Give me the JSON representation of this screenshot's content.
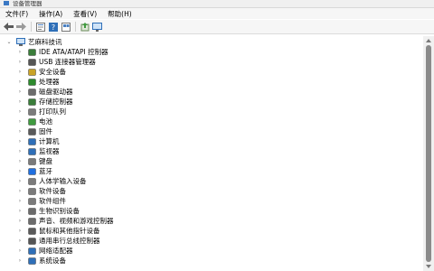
{
  "window": {
    "title": "设备管理器"
  },
  "menu": [
    "文件(F)",
    "操作(A)",
    "查看(V)",
    "帮助(H)"
  ],
  "toolbar": {
    "buttons": [
      "back-icon",
      "forward-icon",
      "properties-icon",
      "help-icon",
      "view-icon",
      "update-driver-icon",
      "monitor-scan-icon"
    ]
  },
  "tree": {
    "root": "艺麻科技讯",
    "categories": [
      {
        "label": "IDE ATA/ATAPI 控制器",
        "icon": "ide-controller-icon",
        "color": "#3a7d3a"
      },
      {
        "label": "USB 连接器管理器",
        "icon": "usb-icon",
        "color": "#555555"
      },
      {
        "label": "安全设备",
        "icon": "security-device-icon",
        "color": "#c9a227"
      },
      {
        "label": "处理器",
        "icon": "processor-icon",
        "color": "#2d8a2d"
      },
      {
        "label": "磁盘驱动器",
        "icon": "disk-drive-icon",
        "color": "#6b6b6b"
      },
      {
        "label": "存储控制器",
        "icon": "storage-controller-icon",
        "color": "#3a7d3a"
      },
      {
        "label": "打印队列",
        "icon": "printer-icon",
        "color": "#7a7a7a"
      },
      {
        "label": "电池",
        "icon": "battery-icon",
        "color": "#3f9a3f"
      },
      {
        "label": "固件",
        "icon": "firmware-icon",
        "color": "#5a5a5a"
      },
      {
        "label": "计算机",
        "icon": "computer-icon",
        "color": "#2f6fb8"
      },
      {
        "label": "监视器",
        "icon": "monitor-icon",
        "color": "#2f6fb8"
      },
      {
        "label": "键盘",
        "icon": "keyboard-icon",
        "color": "#7a7a7a"
      },
      {
        "label": "蓝牙",
        "icon": "bluetooth-icon",
        "color": "#1f6fe0"
      },
      {
        "label": "人体学输入设备",
        "icon": "hid-icon",
        "color": "#7a7a7a"
      },
      {
        "label": "软件设备",
        "icon": "software-device-icon",
        "color": "#7a7a7a"
      },
      {
        "label": "软件组件",
        "icon": "software-component-icon",
        "color": "#7a7a7a"
      },
      {
        "label": "生物识别设备",
        "icon": "biometric-icon",
        "color": "#6b6b6b"
      },
      {
        "label": "声音、视频和游戏控制器",
        "icon": "sound-icon",
        "color": "#6b6b6b"
      },
      {
        "label": "鼠标和其他指针设备",
        "icon": "mouse-icon",
        "color": "#5a5a5a"
      },
      {
        "label": "通用串行总线控制器",
        "icon": "usb-controller-icon",
        "color": "#555555"
      },
      {
        "label": "网络适配器",
        "icon": "network-adapter-icon",
        "color": "#2f6fb8"
      },
      {
        "label": "系统设备",
        "icon": "system-device-icon",
        "color": "#2f6fb8"
      }
    ]
  }
}
